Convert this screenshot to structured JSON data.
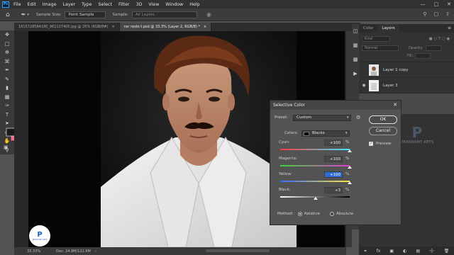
{
  "menubar": {
    "items": [
      "File",
      "Edit",
      "Image",
      "Layer",
      "Type",
      "Select",
      "Filter",
      "3D",
      "View",
      "Window",
      "Help"
    ]
  },
  "optionsbar": {
    "sample_size_label": "Sample Size:",
    "sample_size_value": "Point Sample",
    "sample_label": "Sample:",
    "sample_value": "All Layers"
  },
  "tabs": [
    {
      "label": "1615728584180_961127405.jpg @ 25% (RGB/8#)",
      "active": false
    },
    {
      "label": "nsr resto t.psd @ 33.3% (Layer 2, RGB/8) *",
      "active": true
    }
  ],
  "status": {
    "zoom": "33.33%",
    "doc": "Doc: 24.9M/122.9M"
  },
  "panel": {
    "tabs": [
      "Color",
      "Layers"
    ],
    "active_tab": "Layers",
    "kind_placeholder": "Kind",
    "blend_mode": "Normal",
    "opacity_label": "Opacity:",
    "fill_label": "Fill:",
    "layers": [
      {
        "name": "Layer 1 copy",
        "visible": false,
        "selected": false
      },
      {
        "name": "Layer 3",
        "visible": true,
        "selected": false
      }
    ]
  },
  "dialog": {
    "title": "Selective Color",
    "preset_label": "Preset:",
    "preset_value": "Custom",
    "colors_label": "Colors:",
    "colors_value": "Blacks",
    "ok_label": "OK",
    "cancel_label": "Cancel",
    "preview_label": "Preview",
    "preview_checked": true,
    "sliders": [
      {
        "label": "Cyan:",
        "value": "+100",
        "percent": 100
      },
      {
        "label": "Magenta:",
        "value": "+100",
        "percent": 100
      },
      {
        "label": "Yellow:",
        "value": "+100",
        "percent": 100
      },
      {
        "label": "Black:",
        "value": "+3",
        "percent": 3
      }
    ],
    "pct_sign": "%",
    "method_label": "Method:",
    "method_options": [
      "Relative",
      "Absolute"
    ],
    "method_selected": "Relative"
  },
  "watermark": {
    "text": "PRASHANT ARTS"
  },
  "colors": {
    "accent": "#31a8ff",
    "background_swatch": "#ed6f8e",
    "highlight": "#2f6bd2"
  }
}
